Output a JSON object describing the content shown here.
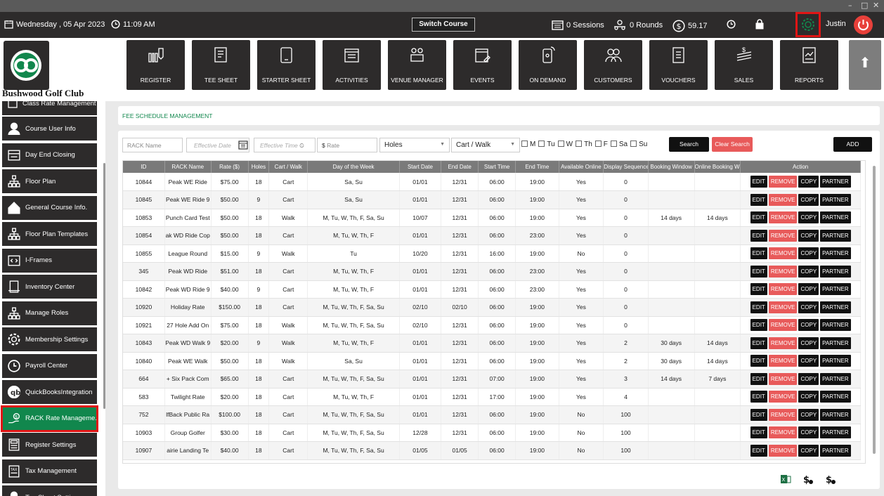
{
  "window": {
    "minimize": "–",
    "maximize": "□",
    "close": "✕"
  },
  "topbar": {
    "date": "Wednesday , 05 Apr 2023",
    "time": "11:09 AM",
    "switch_course": "Switch Course",
    "sessions": "0 Sessions",
    "rounds": "0 Rounds",
    "balance": "59.17",
    "user": "Justin"
  },
  "club_name": "Bushwood Golf Club",
  "nav_tiles": [
    {
      "label": "REGISTER",
      "icon": "barcode-scanner-icon"
    },
    {
      "label": "TEE SHEET",
      "icon": "tee-sheet-icon"
    },
    {
      "label": "STARTER SHEET",
      "icon": "tablet-icon"
    },
    {
      "label": "ACTIVITIES",
      "icon": "calendar-list-icon"
    },
    {
      "label": "VENUE MANAGER",
      "icon": "venue-icon"
    },
    {
      "label": "EVENTS",
      "icon": "calendar-edit-icon"
    },
    {
      "label": "ON DEMAND",
      "icon": "mobile-icon"
    },
    {
      "label": "CUSTOMERS",
      "icon": "users-icon"
    },
    {
      "label": "VOUCHERS",
      "icon": "voucher-icon"
    },
    {
      "label": "SALES",
      "icon": "money-icon"
    },
    {
      "label": "REPORTS",
      "icon": "report-icon"
    }
  ],
  "sidebar": {
    "partial_top": "Class Rate Management",
    "items": [
      {
        "label": "Course User Info",
        "icon": "user-icon"
      },
      {
        "label": "Day End Closing",
        "icon": "register-icon"
      },
      {
        "label": "Floor Plan",
        "icon": "org-chart-icon"
      },
      {
        "label": "General Course Info.",
        "icon": "home-icon"
      },
      {
        "label": "Floor Plan Templates",
        "icon": "org-chart-icon"
      },
      {
        "label": "I-Frames",
        "icon": "code-icon"
      },
      {
        "label": "Inventory Center",
        "icon": "inventory-icon"
      },
      {
        "label": "Manage Roles",
        "icon": "org-chart-icon"
      },
      {
        "label": "Membership Settings",
        "icon": "gear-icon"
      },
      {
        "label": "Payroll Center",
        "icon": "clock-icon"
      },
      {
        "label": "QuickBooksIntegration",
        "icon": "quickbooks-icon"
      },
      {
        "label": "RACK Rate Manageme.",
        "icon": "money-hand-icon",
        "active": true
      },
      {
        "label": "Register Settings",
        "icon": "calculator-icon"
      },
      {
        "label": "Tax Management",
        "icon": "tax-icon"
      },
      {
        "label": "Tee Sheet Settings",
        "icon": "tee-icon"
      }
    ]
  },
  "page_title": "FEE SCHEDULE MANAGEMENT",
  "filters": {
    "rack_name_placeholder": "RACK Name",
    "date_placeholder": "Effective Date",
    "time_placeholder": "Effective Time",
    "rate_placeholder": "Rate",
    "holes": "Holes",
    "cart_walk": "Cart / Walk",
    "days": [
      "M",
      "Tu",
      "W",
      "Th",
      "F",
      "Sa",
      "Su"
    ],
    "search": "Search",
    "clear": "Clear Search",
    "add": "ADD"
  },
  "columns": [
    "ID",
    "RACK Name",
    "Rate ($)",
    "Holes",
    "Cart / Walk",
    "Day of the Week",
    "Start Date",
    "End Date",
    "Start Time",
    "End Time",
    "Available Online",
    "Display Sequence",
    "Booking Window",
    "Online Booking Window",
    "Action"
  ],
  "actions": {
    "edit": "EDIT",
    "remove": "REMOVE",
    "copy": "COPY",
    "partner": "PARTNER"
  },
  "rows": [
    [
      "10844",
      "Peak WE Ride",
      "$75.00",
      "18",
      "Cart",
      "Sa, Su",
      "01/01",
      "12/31",
      "06:00",
      "19:00",
      "Yes",
      "0",
      "",
      ""
    ],
    [
      "10845",
      "Peak WE Ride 9",
      "$50.00",
      "9",
      "Cart",
      "Sa, Su",
      "01/01",
      "12/31",
      "06:00",
      "19:00",
      "Yes",
      "0",
      "",
      ""
    ],
    [
      "10853",
      "Punch Card Test",
      "$50.00",
      "18",
      "Walk",
      "M, Tu, W, Th, F, Sa, Su",
      "10/07",
      "12/31",
      "06:00",
      "19:00",
      "Yes",
      "0",
      "14 days",
      "14 days"
    ],
    [
      "10854",
      "ak WD Ride Cop",
      "$50.00",
      "18",
      "Cart",
      "M, Tu, W, Th, F",
      "01/01",
      "12/31",
      "06:00",
      "23:00",
      "Yes",
      "0",
      "",
      ""
    ],
    [
      "10855",
      "League Round",
      "$15.00",
      "9",
      "Walk",
      "Tu",
      "10/20",
      "12/31",
      "16:00",
      "19:00",
      "No",
      "0",
      "",
      ""
    ],
    [
      "345",
      "Peak WD Ride",
      "$51.00",
      "18",
      "Cart",
      "M, Tu, W, Th, F",
      "01/01",
      "12/31",
      "06:00",
      "23:00",
      "Yes",
      "0",
      "",
      ""
    ],
    [
      "10842",
      "Peak WD Ride 9",
      "$40.00",
      "9",
      "Cart",
      "M, Tu, W, Th, F",
      "01/01",
      "12/31",
      "06:00",
      "23:00",
      "Yes",
      "0",
      "",
      ""
    ],
    [
      "10920",
      "Holiday Rate",
      "$150.00",
      "18",
      "Cart",
      "M, Tu, W, Th, F, Sa, Su",
      "02/10",
      "02/10",
      "06:00",
      "19:00",
      "Yes",
      "0",
      "",
      ""
    ],
    [
      "10921",
      "27 Hole Add On",
      "$75.00",
      "18",
      "Walk",
      "M, Tu, W, Th, F, Sa, Su",
      "02/10",
      "12/31",
      "06:00",
      "19:00",
      "Yes",
      "0",
      "",
      ""
    ],
    [
      "10843",
      "Peak WD Walk 9",
      "$20.00",
      "9",
      "Walk",
      "M, Tu, W, Th, F",
      "01/01",
      "12/31",
      "06:00",
      "19:00",
      "Yes",
      "2",
      "30 days",
      "14 days"
    ],
    [
      "10840",
      "Peak WE Walk",
      "$50.00",
      "18",
      "Walk",
      "Sa, Su",
      "01/01",
      "12/31",
      "06:00",
      "19:00",
      "Yes",
      "2",
      "30 days",
      "14 days"
    ],
    [
      "664",
      "+ Six Pack Com",
      "$65.00",
      "18",
      "Cart",
      "M, Tu, W, Th, F, Sa, Su",
      "01/01",
      "12/31",
      "07:00",
      "19:00",
      "Yes",
      "3",
      "14 days",
      "7 days"
    ],
    [
      "583",
      "Twilight Rate",
      "$20.00",
      "18",
      "Cart",
      "M, Tu, W, Th, F",
      "01/01",
      "12/31",
      "17:00",
      "19:00",
      "Yes",
      "4",
      "",
      ""
    ],
    [
      "752",
      "lfBack Public Ra",
      "$100.00",
      "18",
      "Cart",
      "M, Tu, W, Th, F, Sa, Su",
      "01/01",
      "12/31",
      "06:00",
      "19:00",
      "No",
      "100",
      "",
      ""
    ],
    [
      "10903",
      "Group Golfer",
      "$30.00",
      "18",
      "Cart",
      "M, Tu, W, Th, F, Sa, Su",
      "12/28",
      "12/31",
      "06:00",
      "19:00",
      "No",
      "100",
      "",
      ""
    ],
    [
      "10907",
      "airie Landing Te",
      "$40.00",
      "18",
      "Cart",
      "M, Tu, W, Th, F, Sa, Su",
      "01/05",
      "01/05",
      "06:00",
      "19:00",
      "No",
      "100",
      "",
      ""
    ]
  ]
}
